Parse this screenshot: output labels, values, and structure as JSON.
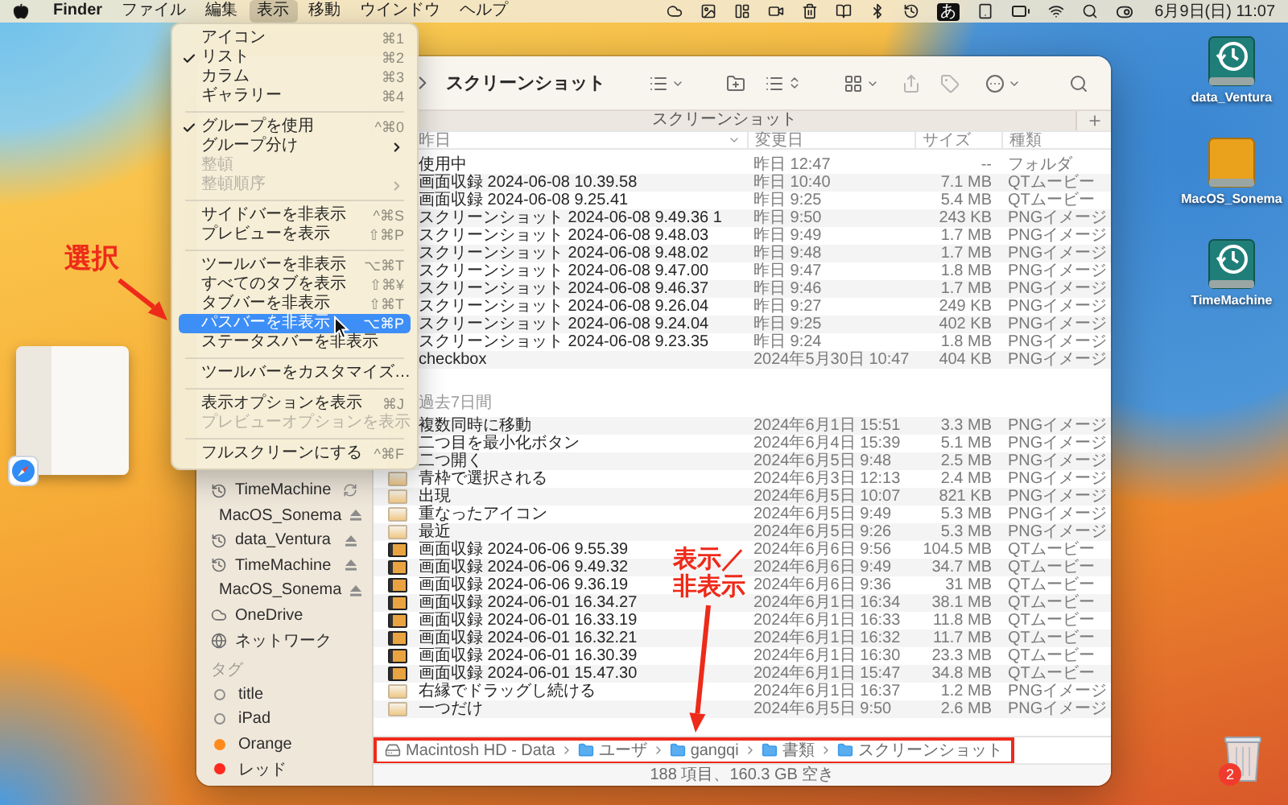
{
  "menu_bar": {
    "items": [
      {
        "label": "Finder",
        "kind": "app",
        "selected": false
      },
      {
        "label": "ファイル",
        "kind": "menu",
        "selected": false
      },
      {
        "label": "編集",
        "kind": "menu",
        "selected": false
      },
      {
        "label": "表示",
        "kind": "menu",
        "selected": true
      },
      {
        "label": "移動",
        "kind": "menu",
        "selected": false
      },
      {
        "label": "ウインドウ",
        "kind": "menu",
        "selected": false
      },
      {
        "label": "ヘルプ",
        "kind": "menu",
        "selected": false
      }
    ],
    "input_source": "あ",
    "clock": "6月9日(日) 11:07"
  },
  "view_menu": {
    "items": [
      {
        "kind": "item",
        "label": "アイコン",
        "shortcut": "⌘1",
        "checked": false,
        "disabled": false,
        "submenu": false,
        "selected": false
      },
      {
        "kind": "item",
        "label": "リスト",
        "shortcut": "⌘2",
        "checked": true,
        "disabled": false,
        "submenu": false,
        "selected": false
      },
      {
        "kind": "item",
        "label": "カラム",
        "shortcut": "⌘3",
        "checked": false,
        "disabled": false,
        "submenu": false,
        "selected": false
      },
      {
        "kind": "item",
        "label": "ギャラリー",
        "shortcut": "⌘4",
        "checked": false,
        "disabled": false,
        "submenu": false,
        "selected": false
      },
      {
        "kind": "separator"
      },
      {
        "kind": "item",
        "label": "グループを使用",
        "shortcut": "^⌘0",
        "checked": true,
        "disabled": false,
        "submenu": false,
        "selected": false
      },
      {
        "kind": "item",
        "label": "グループ分け",
        "checked": false,
        "disabled": false,
        "submenu": true,
        "selected": false
      },
      {
        "kind": "item",
        "label": "整頓",
        "checked": false,
        "disabled": true,
        "submenu": false,
        "selected": false
      },
      {
        "kind": "item",
        "label": "整頓順序",
        "checked": false,
        "disabled": true,
        "submenu": true,
        "selected": false
      },
      {
        "kind": "separator"
      },
      {
        "kind": "item",
        "label": "サイドバーを非表示",
        "shortcut": "^⌘S",
        "checked": false,
        "disabled": false,
        "submenu": false,
        "selected": false
      },
      {
        "kind": "item",
        "label": "プレビューを表示",
        "shortcut": "⇧⌘P",
        "checked": false,
        "disabled": false,
        "submenu": false,
        "selected": false
      },
      {
        "kind": "separator"
      },
      {
        "kind": "item",
        "label": "ツールバーを非表示",
        "shortcut": "⌥⌘T",
        "checked": false,
        "disabled": false,
        "submenu": false,
        "selected": false
      },
      {
        "kind": "item",
        "label": "すべてのタブを表示",
        "shortcut": "⇧⌘¥",
        "checked": false,
        "disabled": false,
        "submenu": false,
        "selected": false
      },
      {
        "kind": "item",
        "label": "タブバーを非表示",
        "shortcut": "⇧⌘T",
        "checked": false,
        "disabled": false,
        "submenu": false,
        "selected": false
      },
      {
        "kind": "item",
        "label": "パスバーを非表示",
        "shortcut": "⌥⌘P",
        "checked": false,
        "disabled": false,
        "submenu": false,
        "selected": true
      },
      {
        "kind": "item",
        "label": "ステータスバーを非表示",
        "checked": false,
        "disabled": false,
        "submenu": false,
        "selected": false
      },
      {
        "kind": "separator"
      },
      {
        "kind": "item",
        "label": "ツールバーをカスタマイズ…",
        "checked": false,
        "disabled": false,
        "submenu": false,
        "selected": false
      },
      {
        "kind": "separator"
      },
      {
        "kind": "item",
        "label": "表示オプションを表示",
        "shortcut": "⌘J",
        "checked": false,
        "disabled": false,
        "submenu": false,
        "selected": false
      },
      {
        "kind": "item",
        "label": "プレビューオプションを表示",
        "checked": false,
        "disabled": true,
        "submenu": false,
        "selected": false
      },
      {
        "kind": "separator"
      },
      {
        "kind": "item",
        "label": "フルスクリーンにする",
        "shortcut": "^⌘F",
        "checked": false,
        "disabled": false,
        "submenu": false,
        "selected": false
      }
    ]
  },
  "finder": {
    "title": "スクリーンショット",
    "tab": "スクリーンショット",
    "sidebar": {
      "items": [
        {
          "label": "TimeMachine",
          "kind": "syncing"
        },
        {
          "label": "MacOS_Sonema",
          "kind": "volume"
        },
        {
          "label": "data_Ventura",
          "kind": "backup"
        },
        {
          "label": "TimeMachine",
          "kind": "backup"
        },
        {
          "label": "MacOS_Sonema",
          "kind": "volume"
        },
        {
          "label": "OneDrive",
          "kind": "cloud"
        },
        {
          "label": "ネットワーク",
          "kind": "network"
        }
      ],
      "tags_heading": "タグ",
      "tags": [
        {
          "label": "title",
          "kind": "outline",
          "color": "#8e8e8e"
        },
        {
          "label": "iPad",
          "kind": "outline",
          "color": "#8e8e8e"
        },
        {
          "label": "Orange",
          "kind": "dot",
          "color": "#ff8a1c"
        },
        {
          "label": "レッド",
          "kind": "dot",
          "color": "#ff2a1f"
        }
      ]
    },
    "columns": [
      {
        "label": "昨日",
        "sorted": true
      },
      {
        "label": "変更日",
        "sorted": false
      },
      {
        "label": "サイズ",
        "sorted": false
      },
      {
        "label": "種類",
        "sorted": false
      }
    ],
    "groups": [
      {
        "rows": [
          {
            "name": "使用中",
            "modified": "昨日 12:47",
            "size": "--",
            "type": "フォルダ"
          },
          {
            "name": "画面収録 2024-06-08 10.39.58",
            "modified": "昨日 10:40",
            "size": "7.1 MB",
            "type": "QTムービー"
          },
          {
            "name": "画面収録 2024-06-08 9.25.41",
            "modified": "昨日 9:25",
            "size": "5.4 MB",
            "type": "QTムービー"
          },
          {
            "name": "スクリーンショット 2024-06-08 9.49.36 1",
            "modified": "昨日 9:50",
            "size": "243 KB",
            "type": "PNGイメージ"
          },
          {
            "name": "スクリーンショット 2024-06-08 9.48.03",
            "modified": "昨日 9:49",
            "size": "1.7 MB",
            "type": "PNGイメージ"
          },
          {
            "name": "スクリーンショット 2024-06-08 9.48.02",
            "modified": "昨日 9:48",
            "size": "1.7 MB",
            "type": "PNGイメージ"
          },
          {
            "name": "スクリーンショット 2024-06-08 9.47.00",
            "modified": "昨日 9:47",
            "size": "1.8 MB",
            "type": "PNGイメージ"
          },
          {
            "name": "スクリーンショット 2024-06-08 9.46.37",
            "modified": "昨日 9:46",
            "size": "1.7 MB",
            "type": "PNGイメージ"
          },
          {
            "name": "スクリーンショット 2024-06-08 9.26.04",
            "modified": "昨日 9:27",
            "size": "249 KB",
            "type": "PNGイメージ"
          },
          {
            "name": "スクリーンショット 2024-06-08 9.24.04",
            "modified": "昨日 9:25",
            "size": "402 KB",
            "type": "PNGイメージ"
          },
          {
            "name": "スクリーンショット 2024-06-08 9.23.35",
            "modified": "昨日 9:24",
            "size": "1.8 MB",
            "type": "PNGイメージ"
          },
          {
            "name": "checkbox",
            "modified": "2024年5月30日 10:47",
            "size": "404 KB",
            "type": "PNGイメージ"
          }
        ]
      },
      {
        "title": "過去7日間",
        "rows": [
          {
            "name": "複数同時に移動",
            "modified": "2024年6月1日 15:51",
            "size": "3.3 MB",
            "type": "PNGイメージ",
            "kind": "image"
          },
          {
            "name": "二つ目を最小化ボタン",
            "modified": "2024年6月4日 15:39",
            "size": "5.1 MB",
            "type": "PNGイメージ",
            "kind": "image"
          },
          {
            "name": "二つ開く",
            "modified": "2024年6月5日 9:48",
            "size": "2.5 MB",
            "type": "PNGイメージ",
            "kind": "image"
          },
          {
            "name": "青枠で選択される",
            "modified": "2024年6月3日 12:13",
            "size": "2.4 MB",
            "type": "PNGイメージ",
            "kind": "image"
          },
          {
            "name": "出現",
            "modified": "2024年6月5日 10:07",
            "size": "821 KB",
            "type": "PNGイメージ",
            "kind": "image"
          },
          {
            "name": "重なったアイコン",
            "modified": "2024年6月5日 9:49",
            "size": "5.3 MB",
            "type": "PNGイメージ",
            "kind": "image"
          },
          {
            "name": "最近",
            "modified": "2024年6月5日 9:26",
            "size": "5.3 MB",
            "type": "PNGイメージ",
            "kind": "image"
          },
          {
            "name": "画面収録 2024-06-06 9.55.39",
            "modified": "2024年6月6日 9:56",
            "size": "104.5 MB",
            "type": "QTムービー",
            "kind": "movie"
          },
          {
            "name": "画面収録 2024-06-06 9.49.32",
            "modified": "2024年6月6日 9:49",
            "size": "34.7 MB",
            "type": "QTムービー",
            "kind": "movie"
          },
          {
            "name": "画面収録 2024-06-06 9.36.19",
            "modified": "2024年6月6日 9:36",
            "size": "31 MB",
            "type": "QTムービー",
            "kind": "movie"
          },
          {
            "name": "画面収録 2024-06-01 16.34.27",
            "modified": "2024年6月1日 16:34",
            "size": "38.1 MB",
            "type": "QTムービー",
            "kind": "movie"
          },
          {
            "name": "画面収録 2024-06-01 16.33.19",
            "modified": "2024年6月1日 16:33",
            "size": "11.8 MB",
            "type": "QTムービー",
            "kind": "movie"
          },
          {
            "name": "画面収録 2024-06-01 16.32.21",
            "modified": "2024年6月1日 16:32",
            "size": "11.7 MB",
            "type": "QTムービー",
            "kind": "movie"
          },
          {
            "name": "画面収録 2024-06-01 16.30.39",
            "modified": "2024年6月1日 16:30",
            "size": "23.3 MB",
            "type": "QTムービー",
            "kind": "movie"
          },
          {
            "name": "画面収録 2024-06-01 15.47.30",
            "modified": "2024年6月1日 15:47",
            "size": "34.8 MB",
            "type": "QTムービー",
            "kind": "movie"
          },
          {
            "name": "右縁でドラッグし続ける",
            "modified": "2024年6月1日 16:37",
            "size": "1.2 MB",
            "type": "PNGイメージ",
            "kind": "image"
          },
          {
            "name": "一つだけ",
            "modified": "2024年6月5日 9:50",
            "size": "2.6 MB",
            "type": "PNGイメージ",
            "kind": "image"
          }
        ]
      }
    ],
    "path": [
      {
        "label": "Macintosh HD - Data",
        "kind": "drive"
      },
      {
        "label": "ユーザ",
        "kind": "folder"
      },
      {
        "label": "gangqi",
        "kind": "folder"
      },
      {
        "label": "書類",
        "kind": "folder"
      },
      {
        "label": "スクリーンショット",
        "kind": "folder"
      }
    ],
    "status": "188 項目、160.3 GB 空き"
  },
  "annotations": [
    {
      "text": "選択"
    },
    {
      "text": "表示／非表示"
    }
  ],
  "desktop_icons": [
    {
      "label": "data_Ventura",
      "kind": "timemachine"
    },
    {
      "label": "MacOS_Sonema",
      "kind": "drive"
    },
    {
      "label": "TimeMachine",
      "kind": "timemachine"
    }
  ],
  "trash": {
    "badge": "2"
  }
}
